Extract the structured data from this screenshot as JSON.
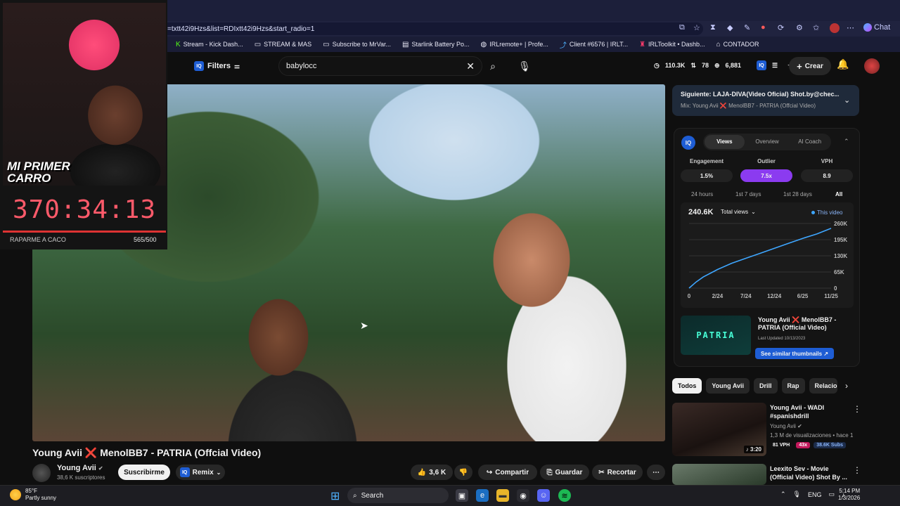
{
  "browser": {
    "url": "=txtt42i9Hzs&list=RDIxtt42i9Hzs&start_radio=1",
    "chat_label": "Chat",
    "bookmarks": [
      {
        "label": "Stream - Kick Dash...",
        "icon": "kick-icon"
      },
      {
        "label": "STREAM & MAS",
        "icon": "folder-icon"
      },
      {
        "label": "Subscribe to MrVar...",
        "icon": "folder-icon"
      },
      {
        "label": "Starlink Battery Po...",
        "icon": "page-icon"
      },
      {
        "label": "IRLremote+ | Profe...",
        "icon": "globe-icon"
      },
      {
        "label": "Client #6576 | IRLT...",
        "icon": "link-icon"
      },
      {
        "label": "IRLToolkit • Dashb...",
        "icon": "toolkit-icon"
      },
      {
        "label": "CONTADOR",
        "icon": "counter-icon"
      }
    ]
  },
  "topbar": {
    "filters_label": "Filters",
    "search_value": "babylocc",
    "stats": {
      "views": "110.3K",
      "likes": "78",
      "subs": "6,881"
    },
    "create_label": "Crear"
  },
  "overlay": {
    "title_line1": "MI PRIMER",
    "title_line2": "CARRO",
    "timer": "370:34:13",
    "goal_label": "RAPARME A CACO",
    "goal_count": "565/500"
  },
  "video": {
    "title": "Young Avii ❌ MenolBB7 - PATRIA (Offcial Video)",
    "channel": "Young Avii",
    "subscribers": "38,6 K suscriptores",
    "subscribe_label": "Suscribirme",
    "remix_label": "Remix",
    "likes": "3,6 K",
    "share_label": "Compartir",
    "save_label": "Guardar",
    "clip_label": "Recortar"
  },
  "next_up": {
    "title": "Siguiente: LAJA-DIVA(Video Oficial) Shot.by@chec...",
    "subtitle": "Mix: Young Avii ❌ MenolBB7 - PATRIA (Offcial Video)"
  },
  "iq_panel": {
    "logo": "IQ",
    "tabs": [
      "Views",
      "Overview",
      "AI Coach"
    ],
    "active_tab": 0,
    "metrics": [
      {
        "label": "Engagement",
        "value": "1.5%"
      },
      {
        "label": "Outlier",
        "value": "7.5x"
      },
      {
        "label": "VPH",
        "value": "8.9"
      }
    ],
    "ranges": [
      "24 hours",
      "1st 7 days",
      "1st 28 days",
      "All"
    ],
    "active_range": 3,
    "total_views": "240.6K",
    "total_views_select": "Total views",
    "legend": "This video",
    "card_title": "Young Avii ❌ MenolBB7 - PATRIA (Official Video)",
    "card_updated": "Last Updated 10/13/2023",
    "card_thumb_text": "PATRIA",
    "similar_label": "See similar thumbnails ↗"
  },
  "chart_data": {
    "type": "line",
    "x_ticks": [
      "0",
      "2/24",
      "7/24",
      "12/24",
      "6/25",
      "11/25"
    ],
    "y_ticks": [
      "260K",
      "195K",
      "130K",
      "65K",
      "0"
    ],
    "ylim": [
      0,
      260000
    ],
    "series": [
      {
        "name": "This video",
        "x": [
          0,
          0.05,
          0.1,
          0.2,
          0.3,
          0.4,
          0.5,
          0.6,
          0.7,
          0.8,
          0.9,
          1.0
        ],
        "values": [
          0,
          25000,
          45000,
          75000,
          100000,
          120000,
          140000,
          160000,
          180000,
          200000,
          218000,
          240600
        ]
      }
    ],
    "grid": true,
    "legend": "top-right"
  },
  "chips": [
    "Todos",
    "Young Avii",
    "Drill",
    "Rap",
    "Relacion"
  ],
  "recommendations": [
    {
      "title": "Young Avii - WADI #spanishdrill",
      "channel": "Young Avii",
      "meta": "1,3 M de visualizaciones • hace 1 ...",
      "duration": "3:20",
      "vph": "81 VPH",
      "outlier": "43x",
      "subs": "38.6K Subs"
    },
    {
      "title": "Leexito Sev - Movie (Official Video) Shot By ...",
      "channel": "",
      "meta": "",
      "duration": "",
      "vph": "",
      "outlier": "",
      "subs": ""
    }
  ],
  "taskbar": {
    "temperature": "85°F",
    "weather": "Partly sunny",
    "search_label": "Search",
    "language": "ENG",
    "time": "5:14 PM",
    "date": "1/3/2026"
  },
  "colors": {
    "accent_blue": "#1e5dd4",
    "outlier_purple": "#8b3bf0",
    "timer_red": "#ff5a6a",
    "chart_line": "#3ea6ff"
  }
}
